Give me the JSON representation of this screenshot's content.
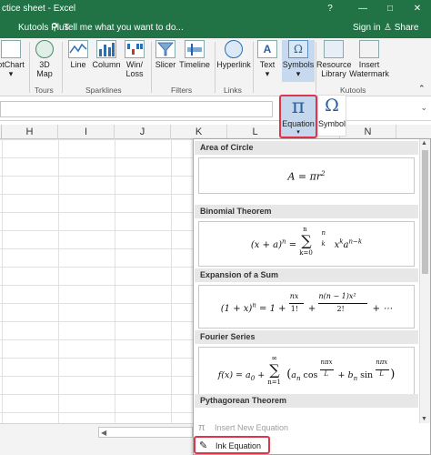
{
  "window": {
    "title": "ctice sheet - Excel",
    "controls": [
      "?",
      "—",
      "□",
      "✕"
    ]
  },
  "tabs": {
    "kutools_plus": "Kutools Plus",
    "tell_me": "Tell me what you want to do...",
    "sign_in": "Sign in",
    "share": "Share"
  },
  "ribbon": {
    "buttons": {
      "pivot": "otChart",
      "map3d_1": "3D",
      "map3d_2": "Map",
      "line": "Line",
      "column": "Column",
      "winloss_1": "Win/",
      "winloss_2": "Loss",
      "slicer": "Slicer",
      "timeline": "Timeline",
      "hyperlink": "Hyperlink",
      "text": "Text",
      "symbols": "Symbols",
      "resource_1": "Resource",
      "resource_2": "Library",
      "watermark_1": "Insert",
      "watermark_2": "Watermark"
    },
    "groups": {
      "tours": "Tours",
      "sparklines": "Sparklines",
      "filters": "Filters",
      "links": "Links",
      "kutools": "Kutools"
    }
  },
  "equation_button": {
    "glyph": "π",
    "label": "Equation",
    "caret": "▾"
  },
  "symbol_button": {
    "glyph": "Ω",
    "label": "Symbol"
  },
  "columns": [
    "H",
    "I",
    "J",
    "K",
    "L",
    "M",
    "N"
  ],
  "gallery": {
    "sections": [
      {
        "title": "Area of Circle"
      },
      {
        "title": "Binomial Theorem"
      },
      {
        "title": "Expansion of a Sum"
      },
      {
        "title": "Fourier Series"
      },
      {
        "title": "Pythagorean Theorem"
      }
    ],
    "formulas": {
      "area": {
        "lhs": "A = πr",
        "sup": "2"
      },
      "binomial": {
        "lhs": "(x + a)",
        "lhs_sup": "n",
        "eq": "=",
        "sigma": "∑",
        "sigma_top": "n",
        "sigma_bot": "k=0",
        "binom_top": "n",
        "binom_bot": "k",
        "term": "x",
        "term_sup": "k",
        "term2": "a",
        "term2_sup": "n−k"
      },
      "expansion": {
        "lhs": "(1 + x)",
        "lhs_sup": "n",
        "eq1": "= 1 +",
        "frac1_num": "nx",
        "frac1_den": "1!",
        "plus": "+",
        "frac2_num": "n(n − 1)x²",
        "frac2_den": "2!",
        "tail": "+ ⋯"
      },
      "fourier": {
        "lhs": "f(x) = a",
        "lhs_sub": "0",
        "plus": "+",
        "sigma": "∑",
        "sigma_top": "∞",
        "sigma_bot": "n=1",
        "open": "(",
        "a": "a",
        "a_sub": "n",
        "cos": "cos",
        "f1_num": "nπx",
        "f1_den": "L",
        "plus2": "+ b",
        "b_sub": "n",
        "sin": "sin",
        "f2_num": "nπx",
        "f2_den": "L",
        "close": ")"
      }
    },
    "footer": {
      "insert_new_icon": "π",
      "insert_new": "Insert New Equation",
      "ink_icon": "✎",
      "ink": "Ink Equation"
    }
  },
  "colors": {
    "excel_green": "#217346",
    "highlight_red": "#e0344a",
    "ribbon_bg": "#f3f3f3",
    "selected_blue": "#c4d7ec"
  }
}
